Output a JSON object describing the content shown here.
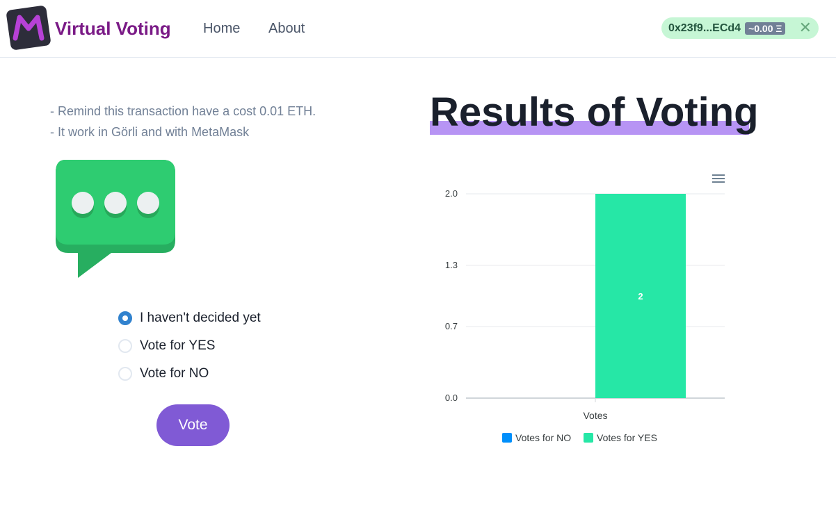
{
  "header": {
    "brand": "Virtual Voting",
    "nav": [
      {
        "label": "Home"
      },
      {
        "label": "About"
      }
    ],
    "wallet": {
      "address": "0x23f9...ECd4",
      "balance": "~0.00 Ξ",
      "close": "✕"
    }
  },
  "notes": [
    "- Remind this transaction have a cost 0.01 ETH.",
    "- It work in Görli and with MetaMask"
  ],
  "options": [
    {
      "label": "I haven't decided yet",
      "checked": true
    },
    {
      "label": "Vote for YES",
      "checked": false
    },
    {
      "label": "Vote for NO",
      "checked": false
    }
  ],
  "vote_button": "Vote",
  "results_title": "Results of Voting",
  "colors": {
    "accent": "#805ad5",
    "brand": "#7a1a86",
    "no": "#008ffb",
    "yes": "#26e7a6"
  },
  "chart_data": {
    "type": "bar",
    "categories": [
      "Votes"
    ],
    "series": [
      {
        "name": "Votes for NO",
        "values": [
          0
        ],
        "color": "#008ffb"
      },
      {
        "name": "Votes for YES",
        "values": [
          2
        ],
        "color": "#26e7a6"
      }
    ],
    "yticks": [
      "2.0",
      "1.3",
      "0.7",
      "0.0"
    ],
    "ylim": [
      0,
      2
    ],
    "data_labels": [
      "2"
    ],
    "legend_position": "bottom",
    "grid": true,
    "menu_icon": "hamburger-menu-icon"
  }
}
